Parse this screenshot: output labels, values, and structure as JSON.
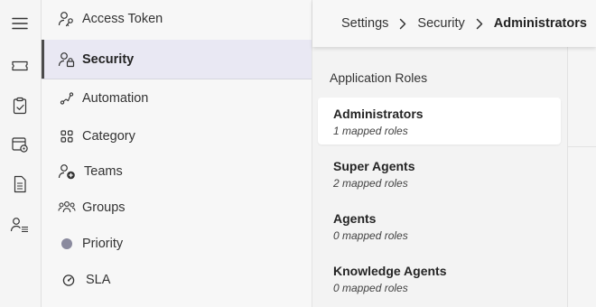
{
  "rail": [
    {
      "icon": "hamburger-menu-icon"
    },
    {
      "icon": "ticket-icon"
    },
    {
      "icon": "clipboard-check-icon"
    },
    {
      "icon": "calendar-settings-icon"
    },
    {
      "icon": "document-icon"
    },
    {
      "icon": "people-list-icon"
    }
  ],
  "nav": {
    "items": [
      {
        "label": "Access Token",
        "icon": "person-key-icon"
      },
      {
        "label": "Security",
        "icon": "person-lock-icon",
        "active": true
      },
      {
        "label": "Automation",
        "icon": "automation-flow-icon"
      },
      {
        "label": "Category",
        "icon": "grid-icon"
      },
      {
        "label": "Teams",
        "icon": "people-add-icon"
      },
      {
        "label": "Groups",
        "icon": "people-team-icon"
      },
      {
        "label": "Priority",
        "icon": "priority-dot-icon",
        "color": "#8a8a9e"
      },
      {
        "label": "SLA",
        "icon": "gauge-icon"
      }
    ]
  },
  "breadcrumb": {
    "items": [
      "Settings",
      "Security"
    ],
    "current": "Administrators"
  },
  "roles": {
    "title": "Application Roles",
    "items": [
      {
        "name": "Administrators",
        "subtitle": "1 mapped roles",
        "selected": true
      },
      {
        "name": "Super Agents",
        "subtitle": "2 mapped roles"
      },
      {
        "name": "Agents",
        "subtitle": "0 mapped roles"
      },
      {
        "name": "Knowledge Agents",
        "subtitle": "0 mapped roles"
      }
    ]
  },
  "colors": {
    "active_nav_bg": "#e9e8f3",
    "priority_dot": "#8a8a9e"
  }
}
